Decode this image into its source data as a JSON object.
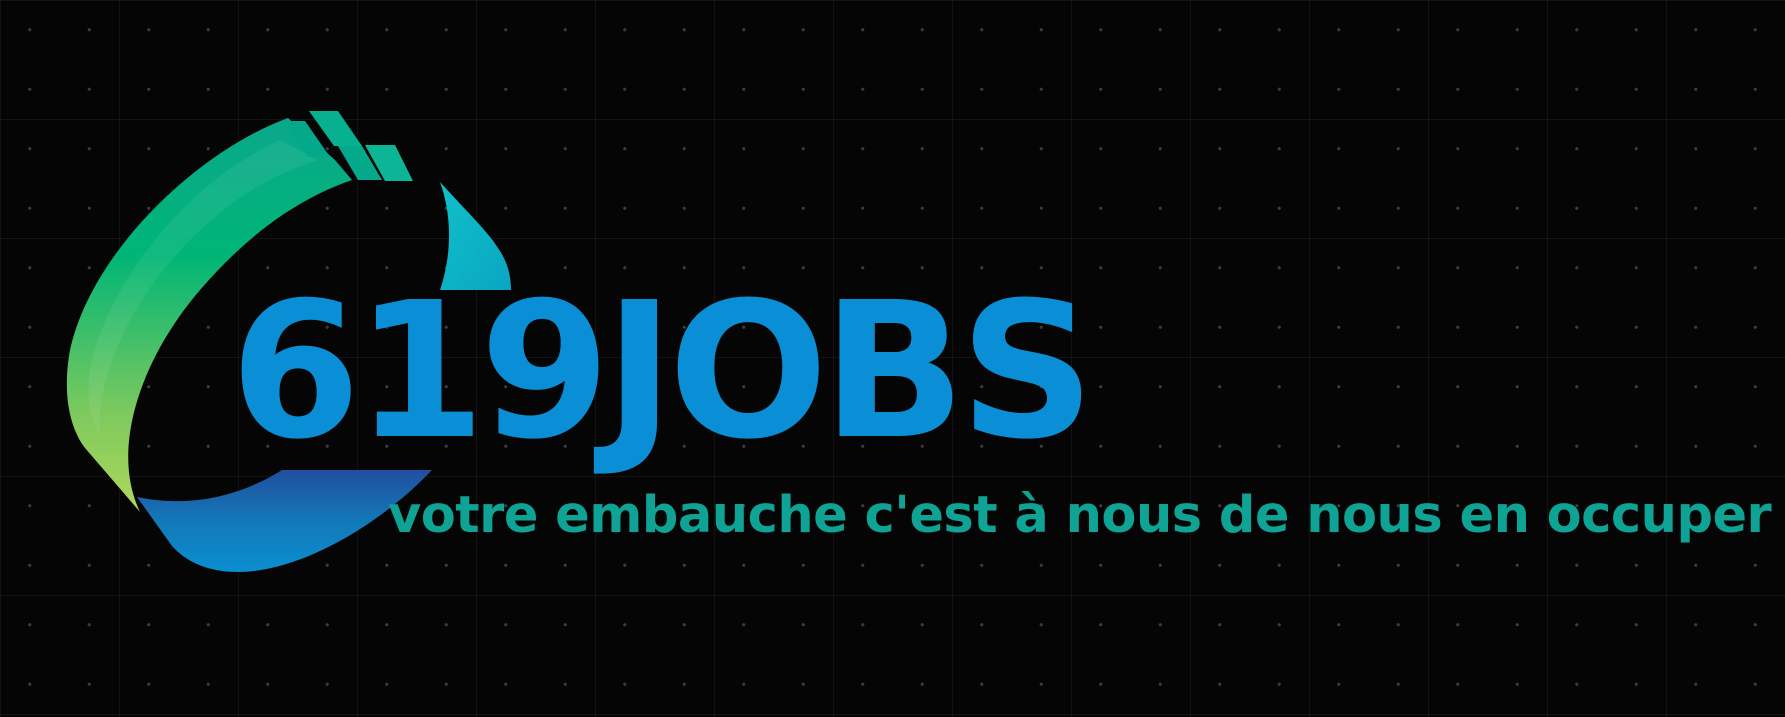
{
  "brand": {
    "name": "619JOBS",
    "tagline": "votre embauche c'est à nous de nous en occuper",
    "logo_icon": "swoosh-ring-icon"
  },
  "colors": {
    "background": "#050505",
    "brand_blue": "#0a8fd6",
    "tagline_teal": "#0ea394",
    "swoosh_green": "#00b576",
    "swoosh_lime": "#a6d65a",
    "swoosh_cyan": "#0ab0c6",
    "swoosh_navy": "#1e58a6"
  }
}
